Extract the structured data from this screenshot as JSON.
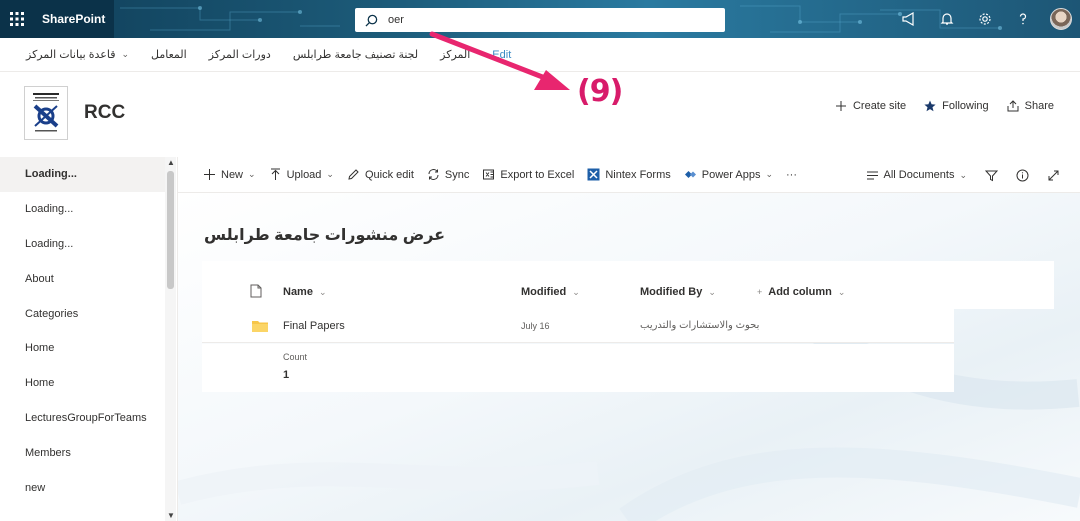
{
  "suite": {
    "app_name": "SharePoint",
    "search_value": "oer"
  },
  "hubnav": {
    "items": [
      {
        "label": "قاعدة بيانات المركز"
      },
      {
        "label": "المعامل"
      },
      {
        "label": "دورات المركز"
      },
      {
        "label": "لجنة تصنيف جامعة طرابلس"
      },
      {
        "label": "المركز"
      }
    ],
    "edit_label": "Edit"
  },
  "site": {
    "title": "RCC",
    "actions": {
      "create": "Create site",
      "following": "Following",
      "share": "Share"
    }
  },
  "annotation": {
    "label": "(9)",
    "color": "#d81b6a"
  },
  "leftnav": {
    "items": [
      {
        "label": "Loading..."
      },
      {
        "label": "Loading..."
      },
      {
        "label": "Loading..."
      },
      {
        "label": "About"
      },
      {
        "label": "Categories"
      },
      {
        "label": "Home"
      },
      {
        "label": "Home"
      },
      {
        "label": "LecturesGroupForTeams"
      },
      {
        "label": "Members"
      },
      {
        "label": "new"
      }
    ]
  },
  "commandbar": {
    "new": "New",
    "upload": "Upload",
    "quick_edit": "Quick edit",
    "sync": "Sync",
    "export": "Export to Excel",
    "nintex": "Nintex Forms",
    "power_apps": "Power Apps",
    "more": "···",
    "view": "All Documents"
  },
  "list": {
    "title": "عرض منشورات جامعة طرابلس",
    "columns": {
      "name": "Name",
      "modified": "Modified",
      "modified_by": "Modified By",
      "add_column": "Add column"
    },
    "rows": [
      {
        "name": "Final Papers",
        "modified": "July 16",
        "modified_by": "بحوث والاستشارات والتدريب"
      }
    ],
    "count_label": "Count",
    "count_value": "1"
  },
  "colors": {
    "brand_dark": "#0b3249",
    "accent_link": "#3b8ac4",
    "folder": "#f7c64a",
    "nintex": "#1e5fa8"
  }
}
